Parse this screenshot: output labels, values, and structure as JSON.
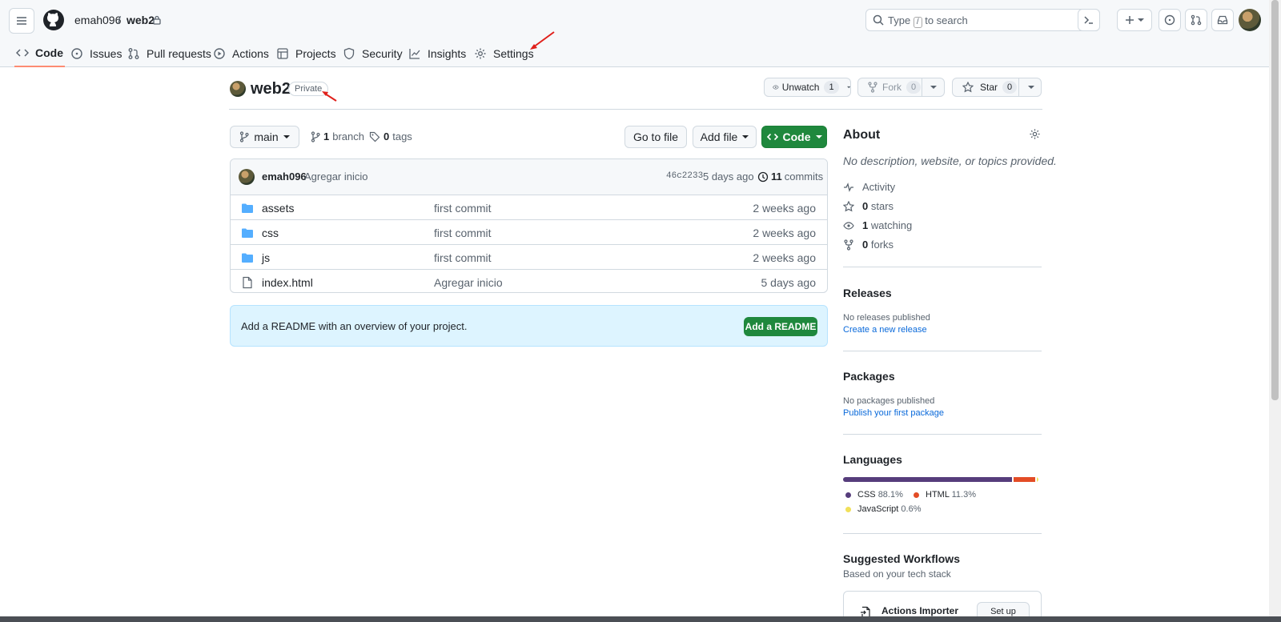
{
  "header": {
    "owner": "emah096",
    "separator": "/",
    "repo": "web2",
    "search_prefix": "Type",
    "search_key": "/",
    "search_suffix": "to search"
  },
  "tabs": [
    {
      "label": "Code",
      "icon": "code-icon"
    },
    {
      "label": "Issues",
      "icon": "issue-icon"
    },
    {
      "label": "Pull requests",
      "icon": "pull-request-icon"
    },
    {
      "label": "Actions",
      "icon": "play-icon"
    },
    {
      "label": "Projects",
      "icon": "table-icon"
    },
    {
      "label": "Security",
      "icon": "shield-icon"
    },
    {
      "label": "Insights",
      "icon": "graph-icon"
    },
    {
      "label": "Settings",
      "icon": "gear-icon"
    }
  ],
  "repo": {
    "name": "web2",
    "visibility": "Private",
    "unwatch_label": "Unwatch",
    "watch_count": "1",
    "fork_label": "Fork",
    "fork_count": "0",
    "star_label": "Star",
    "star_count": "0"
  },
  "toolbar": {
    "branch": "main",
    "branch_count": "1",
    "branch_label": "branch",
    "tag_count": "0",
    "tag_label": "tags",
    "goto_label": "Go to file",
    "addfile_label": "Add file",
    "code_label": "Code"
  },
  "commit": {
    "author": "emah096",
    "message": "Agregar inicio",
    "sha": "46c2233",
    "time": "5 days ago",
    "count": "11",
    "count_label": "commits"
  },
  "files": [
    {
      "name": "assets",
      "type": "dir",
      "message": "first commit",
      "time": "2 weeks ago"
    },
    {
      "name": "css",
      "type": "dir",
      "message": "first commit",
      "time": "2 weeks ago"
    },
    {
      "name": "js",
      "type": "dir",
      "message": "first commit",
      "time": "2 weeks ago"
    },
    {
      "name": "index.html",
      "type": "file",
      "message": "Agregar inicio",
      "time": "5 days ago"
    }
  ],
  "readme": {
    "text": "Add a README with an overview of your project.",
    "button": "Add a README"
  },
  "about": {
    "title": "About",
    "description": "No description, website, or topics provided.",
    "activity": "Activity",
    "stars_count": "0",
    "stars_label": "stars",
    "watching_count": "1",
    "watching_label": "watching",
    "forks_count": "0",
    "forks_label": "forks"
  },
  "releases": {
    "title": "Releases",
    "empty": "No releases published",
    "link": "Create a new release"
  },
  "packages": {
    "title": "Packages",
    "empty": "No packages published",
    "link": "Publish your first package"
  },
  "languages": {
    "title": "Languages",
    "items": [
      {
        "name": "CSS",
        "percent": "88.1%",
        "value": 88.1,
        "color": "#563d7c"
      },
      {
        "name": "HTML",
        "percent": "11.3%",
        "value": 11.3,
        "color": "#e34c26"
      },
      {
        "name": "JavaScript",
        "percent": "0.6%",
        "value": 0.6,
        "color": "#f1e05a"
      }
    ]
  },
  "workflows": {
    "title": "Suggested Workflows",
    "subtitle": "Based on your tech stack",
    "item": "Actions Importer",
    "button": "Set up"
  },
  "colors": {
    "accent_green": "#1f883d",
    "link_blue": "#0969da",
    "annotation_red": "#e0201b"
  }
}
